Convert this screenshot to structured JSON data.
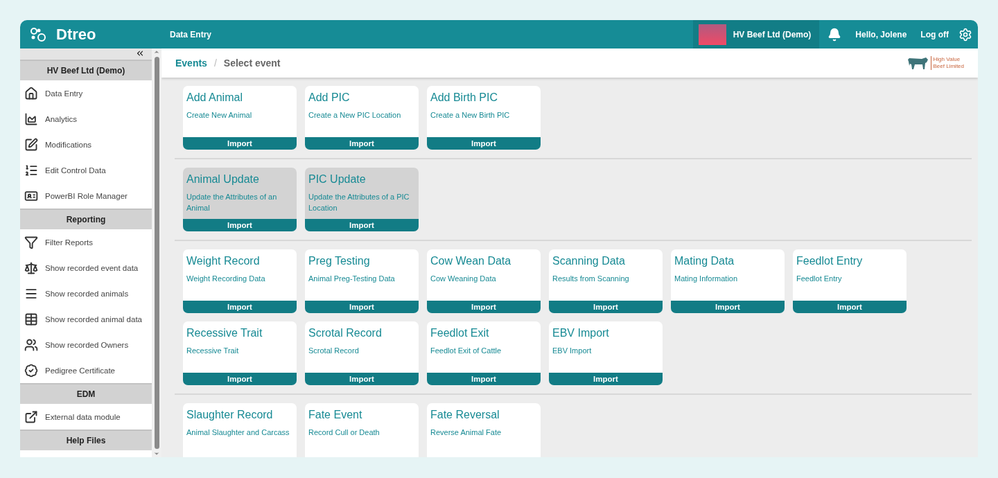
{
  "header": {
    "brand": "Dtreo",
    "section": "Data Entry",
    "organisation": "HV Beef Ltd (Demo)",
    "greeting": "Hello, Jolene",
    "logout": "Log off"
  },
  "sidebar": {
    "sections": [
      {
        "title": "HV Beef Ltd (Demo)",
        "items": [
          {
            "label": "Data Entry"
          },
          {
            "label": "Analytics"
          },
          {
            "label": "Modifications"
          },
          {
            "label": "Edit Control Data"
          },
          {
            "label": "PowerBI Role Manager"
          }
        ]
      },
      {
        "title": "Reporting",
        "items": [
          {
            "label": "Filter Reports"
          },
          {
            "label": "Show recorded event data"
          },
          {
            "label": "Show recorded animals"
          },
          {
            "label": "Show recorded animal data"
          },
          {
            "label": "Show recorded Owners"
          },
          {
            "label": "Pedigree Certificate"
          }
        ]
      },
      {
        "title": "EDM",
        "items": [
          {
            "label": "External data module"
          }
        ]
      },
      {
        "title": "Help Files"
      }
    ]
  },
  "breadcrumb": [
    {
      "label": "Events",
      "link": true
    },
    {
      "label": "Select event",
      "link": false
    }
  ],
  "breadcrumb_separator": "/",
  "partner_logo": {
    "line_1": "High Value",
    "line_2": "Beef Limited"
  },
  "groups": [
    {
      "cards": [
        {
          "title": "Add Animal",
          "subtitle": "Create New Animal",
          "action": "Import",
          "disabled": false
        },
        {
          "title": "Add PIC",
          "subtitle": "Create a New PIC Location",
          "action": "Import",
          "disabled": false
        },
        {
          "title": "Add Birth PIC",
          "subtitle": "Create a New Birth PIC",
          "action": "Import",
          "disabled": false
        }
      ]
    },
    {
      "cards": [
        {
          "title": "Animal Update",
          "subtitle": "Update the Attributes of an Animal",
          "action": "Import",
          "disabled": true
        },
        {
          "title": "PIC Update",
          "subtitle": "Update the Attributes of a PIC Location",
          "action": "Import",
          "disabled": true
        }
      ]
    },
    {
      "cards": [
        {
          "title": "Weight Record",
          "subtitle": "Weight Recording Data",
          "action": "Import",
          "disabled": false
        },
        {
          "title": "Preg Testing",
          "subtitle": "Animal Preg-Testing Data",
          "action": "Import",
          "disabled": false
        },
        {
          "title": "Cow Wean Data",
          "subtitle": "Cow Weaning Data",
          "action": "Import",
          "disabled": false
        },
        {
          "title": "Scanning Data",
          "subtitle": "Results from Scanning",
          "action": "Import",
          "disabled": false
        },
        {
          "title": "Mating Data",
          "subtitle": "Mating Information",
          "action": "Import",
          "disabled": false
        },
        {
          "title": "Feedlot Entry",
          "subtitle": "Feedlot Entry",
          "action": "Import",
          "disabled": false
        },
        {
          "title": "Recessive Trait",
          "subtitle": "Recessive Trait",
          "action": "Import",
          "disabled": false
        },
        {
          "title": "Scrotal Record",
          "subtitle": "Scrotal Record",
          "action": "Import",
          "disabled": false
        },
        {
          "title": "Feedlot Exit",
          "subtitle": "Feedlot Exit of Cattle",
          "action": "Import",
          "disabled": false
        },
        {
          "title": "EBV Import",
          "subtitle": "EBV Import",
          "action": "Import",
          "disabled": false
        }
      ]
    },
    {
      "cards": [
        {
          "title": "Slaughter Record",
          "subtitle": "Animal Slaughter and Carcass",
          "disabled": false
        },
        {
          "title": "Fate Event",
          "subtitle": "Record Cull or Death",
          "disabled": false
        },
        {
          "title": "Fate Reversal",
          "subtitle": "Reverse Animal Fate",
          "disabled": false
        }
      ]
    }
  ]
}
